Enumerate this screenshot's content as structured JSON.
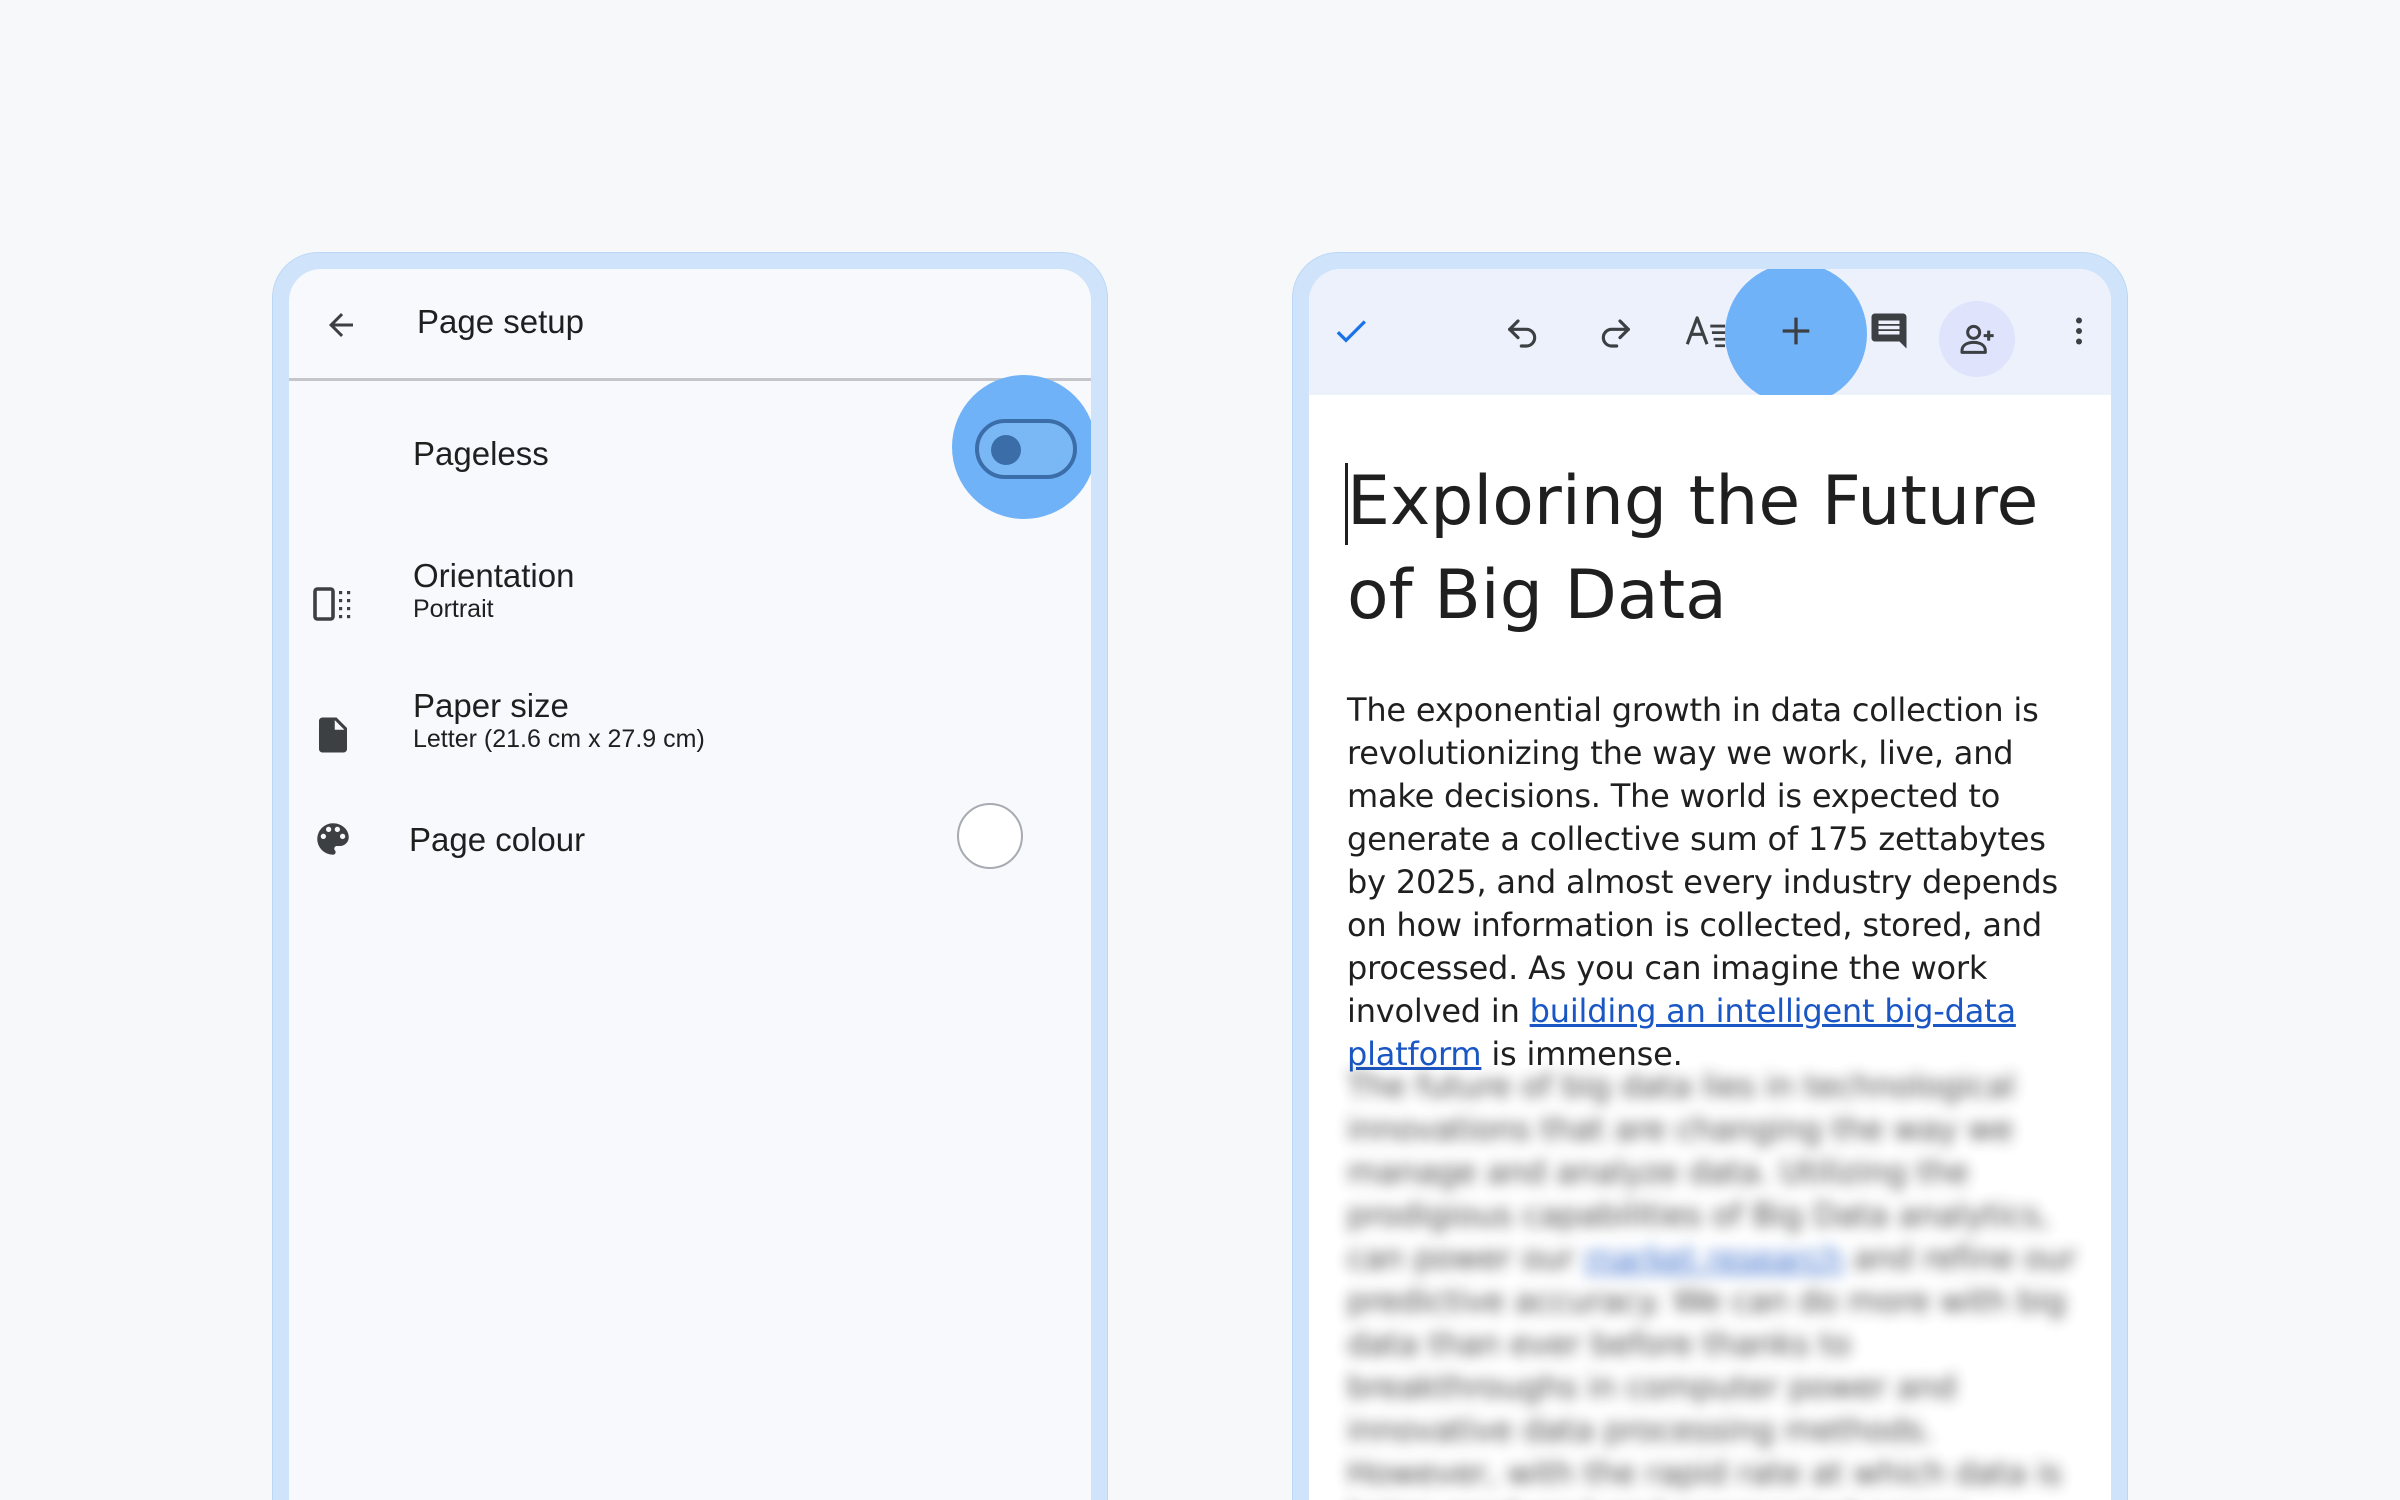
{
  "page_setup": {
    "title": "Page setup",
    "rows": {
      "pageless": {
        "label": "Pageless",
        "enabled": true
      },
      "orientation": {
        "label": "Orientation",
        "value": "Portrait"
      },
      "paper_size": {
        "label": "Paper size",
        "value": "Letter (21.6 cm x 27.9 cm)"
      },
      "page_colour": {
        "label": "Page colour",
        "value_color": "#ffffff"
      }
    }
  },
  "editor": {
    "title": "Exploring the Future of Big Data",
    "para1": {
      "text": "The exponential growth in data collection is revolutionizing the way we work, live, and make decisions. The world is expected to generate a collective sum of 175 zettabytes by 2025, and almost every industry depends on how information is collected, stored, and processed. As you can imagine the work involved in ",
      "link": "building an intelligent big-data platform",
      "after": " is immense."
    },
    "para2": {
      "text": "The future of big data lies in technological innovations that are changing the way we manage and analyze data. Utilizing the prodigious capabilities of Big Data analytics, can power our ",
      "link": "market research",
      "after": " and refine our predictive accuracy. We can do more with big data than ever before thanks to breakthroughs in computer power and innovative data processing methods. However, with the rapid rate at which data is being produced and aggregated across"
    }
  },
  "colors": {
    "highlight": "#6fb2f8",
    "frame": "#cfe4fb",
    "accent": "#1a56c4"
  }
}
